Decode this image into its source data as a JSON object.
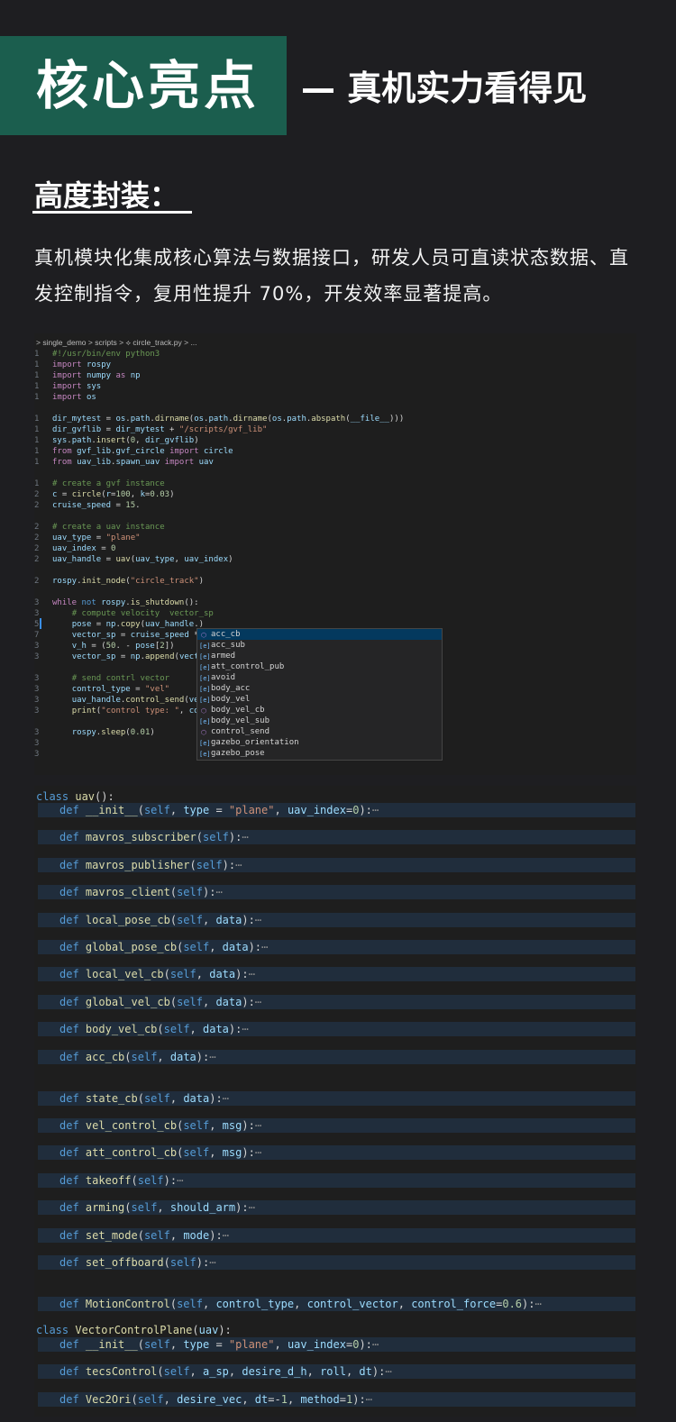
{
  "hero": {
    "title": "核心亮点",
    "subtitle": "— 真机实力看得见"
  },
  "section": {
    "title": "高度封装：",
    "paragraph": "真机模块化集成核心算法与数据接口，研发人员可直读状态数据、直发控制指令，复用性提升 70%，开发效率显著提高。"
  },
  "editor": {
    "breadcrumb": "> single_demo > scripts > ⟡ circle_track.py > ...",
    "lines": [
      {
        "n": "1",
        "t": "#!/usr/bin/env python3"
      },
      {
        "n": "1",
        "t": "import rospy"
      },
      {
        "n": "1",
        "t": "import numpy as np"
      },
      {
        "n": "1",
        "t": "import sys"
      },
      {
        "n": "1",
        "t": "import os"
      },
      {
        "n": "",
        "t": ""
      },
      {
        "n": "1",
        "t": "dir_mytest = os.path.dirname(os.path.dirname(os.path.abspath(__file__)))"
      },
      {
        "n": "1",
        "t": "dir_gvflib = dir_mytest + \"/scripts/gvf_lib\""
      },
      {
        "n": "1",
        "t": "sys.path.insert(0, dir_gvflib)"
      },
      {
        "n": "1",
        "t": "from gvf_lib.gvf_circle import circle"
      },
      {
        "n": "1",
        "t": "from uav_lib.spawn_uav import uav"
      },
      {
        "n": "",
        "t": ""
      },
      {
        "n": "1",
        "t": "# create a gvf instance"
      },
      {
        "n": "2",
        "t": "c = circle(r=100, k=0.03)"
      },
      {
        "n": "2",
        "t": "cruise_speed = 15."
      },
      {
        "n": "",
        "t": ""
      },
      {
        "n": "2",
        "t": "# create a uav instance"
      },
      {
        "n": "2",
        "t": "uav_type = \"plane\""
      },
      {
        "n": "2",
        "t": "uav_index = 0"
      },
      {
        "n": "2",
        "t": "uav_handle = uav(uav_type, uav_index)"
      },
      {
        "n": "",
        "t": ""
      },
      {
        "n": "2",
        "t": "rospy.init_node(\"circle_track\")"
      },
      {
        "n": "",
        "t": ""
      },
      {
        "n": "3",
        "t": "while not rospy.is_shutdown():"
      },
      {
        "n": "3",
        "t": "    # compute velocity  vector_sp"
      },
      {
        "n": "5",
        "t": "    pose = np.copy(uav_handle.)"
      },
      {
        "n": "7",
        "t": "    vector_sp = cruise_speed *"
      },
      {
        "n": "3",
        "t": "    v_h = (50. - pose[2])"
      },
      {
        "n": "3",
        "t": "    vector_sp = np.append(vect"
      },
      {
        "n": "",
        "t": ""
      },
      {
        "n": "3",
        "t": "    # send contrl vector"
      },
      {
        "n": "3",
        "t": "    control_type = \"vel\""
      },
      {
        "n": "3",
        "t": "    uav_handle.control_send(ve"
      },
      {
        "n": "3",
        "t": "    print(\"control type: \", co"
      },
      {
        "n": "",
        "t": ""
      },
      {
        "n": "3",
        "t": "    rospy.sleep(0.01)"
      },
      {
        "n": "3",
        "t": ""
      },
      {
        "n": "3",
        "t": ""
      }
    ],
    "suggestions": [
      {
        "label": "acc_cb",
        "icon": "method-icon"
      },
      {
        "label": "acc_sub",
        "icon": "field-icon"
      },
      {
        "label": "armed",
        "icon": "field-icon"
      },
      {
        "label": "att_control_pub",
        "icon": "field-icon"
      },
      {
        "label": "avoid",
        "icon": "field-icon"
      },
      {
        "label": "body_acc",
        "icon": "field-icon"
      },
      {
        "label": "body_vel",
        "icon": "field-icon"
      },
      {
        "label": "body_vel_cb",
        "icon": "method-icon"
      },
      {
        "label": "body_vel_sub",
        "icon": "field-icon"
      },
      {
        "label": "control_send",
        "icon": "method-icon"
      },
      {
        "label": "gazebo_orientation",
        "icon": "field-icon"
      },
      {
        "label": "gazebo_pose",
        "icon": "field-icon"
      }
    ]
  },
  "outline": {
    "class_uav": "class uav():",
    "methods_uav": [
      "__init__(self, type = \"plane\", uav_index=0):",
      "mavros_subscriber(self):",
      "mavros_publisher(self):",
      "mavros_client(self):",
      "local_pose_cb(self, data):",
      "global_pose_cb(self, data):",
      "local_vel_cb(self, data):",
      "global_vel_cb(self, data):",
      "body_vel_cb(self, data):",
      "acc_cb(self, data):",
      "state_cb(self, data):",
      "vel_control_cb(self, msg):",
      "att_control_cb(self, msg):",
      "takeoff(self):",
      "arming(self, should_arm):",
      "set_mode(self, mode):",
      "set_offboard(self):",
      "MotionControl(self, control_type, control_vector, control_force=0.6):"
    ],
    "class_plane": "class VectorControlPlane(uav):",
    "methods_plane": [
      "__init__(self, type = \"plane\", uav_index=0):",
      "tecsControl(self, a_sp, desire_d_h, roll, dt):",
      "Vec2Ori(self, desire_vec, dt=-1, method=1):"
    ],
    "def_keyword": "def",
    "fold_glyph": "⋯"
  }
}
